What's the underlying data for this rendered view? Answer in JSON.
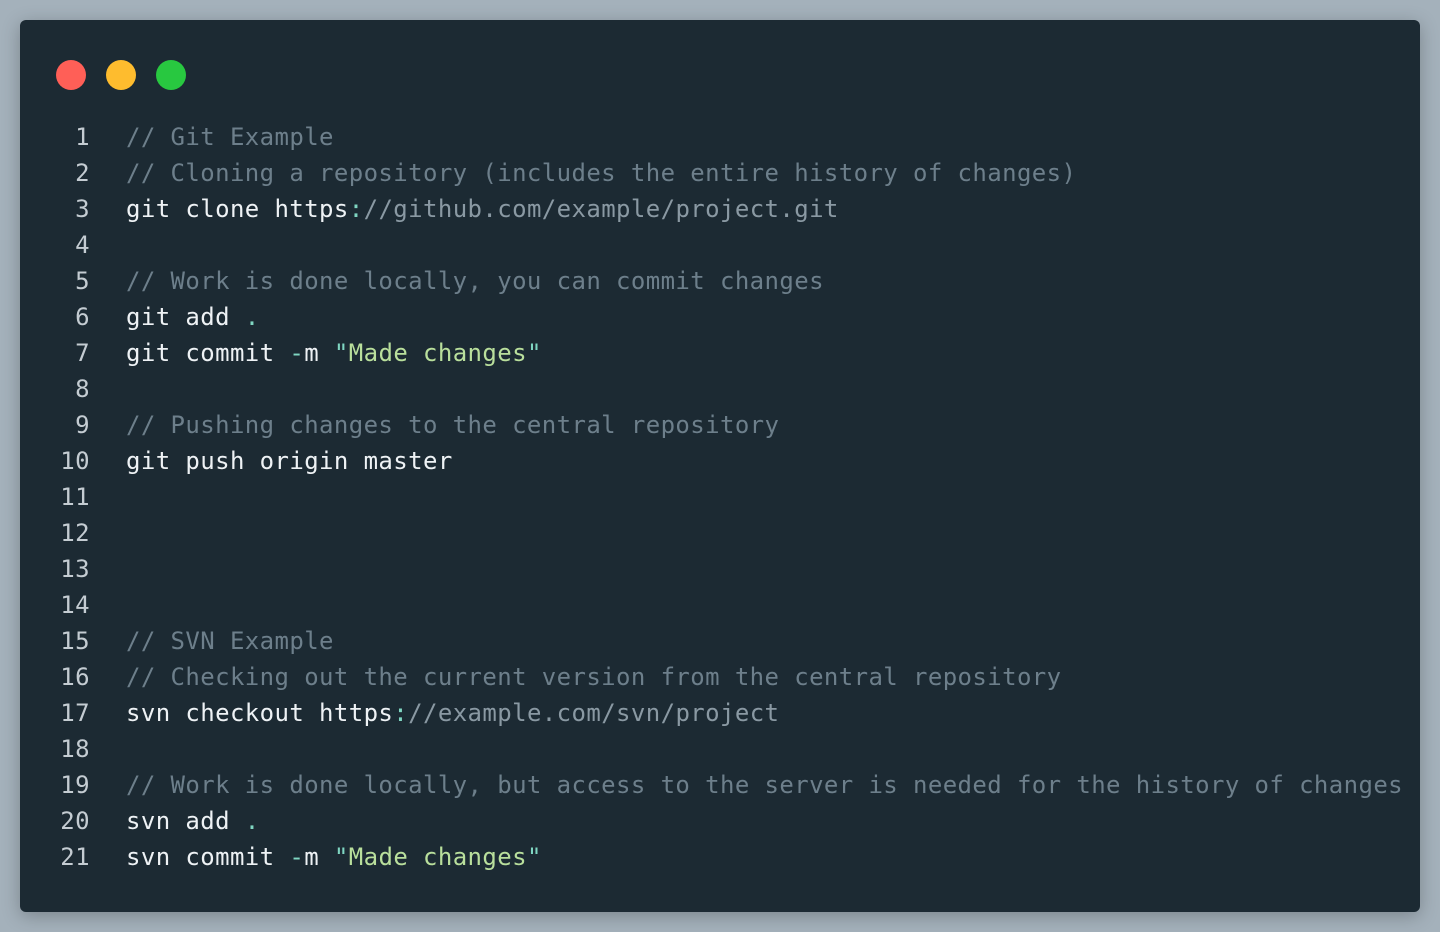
{
  "window": {
    "controls": [
      {
        "name": "close-button",
        "color": "#ff5f57"
      },
      {
        "name": "minimize-button",
        "color": "#febc2e"
      },
      {
        "name": "maximize-button",
        "color": "#28c840"
      }
    ]
  },
  "editor": {
    "lines": [
      {
        "n": "1",
        "tokens": [
          {
            "t": "comment",
            "v": "// Git Example"
          }
        ]
      },
      {
        "n": "2",
        "tokens": [
          {
            "t": "comment",
            "v": "// Cloning a repository (includes the entire history of changes)"
          }
        ]
      },
      {
        "n": "3",
        "tokens": [
          {
            "t": "text",
            "v": "git clone https"
          },
          {
            "t": "punct",
            "v": ":"
          },
          {
            "t": "url",
            "v": "//github.com/example/project.git"
          }
        ]
      },
      {
        "n": "4",
        "tokens": []
      },
      {
        "n": "5",
        "tokens": [
          {
            "t": "comment",
            "v": "// Work is done locally, you can commit changes"
          }
        ]
      },
      {
        "n": "6",
        "tokens": [
          {
            "t": "text",
            "v": "git add "
          },
          {
            "t": "punct",
            "v": "."
          }
        ]
      },
      {
        "n": "7",
        "tokens": [
          {
            "t": "text",
            "v": "git commit "
          },
          {
            "t": "punct",
            "v": "-"
          },
          {
            "t": "text",
            "v": "m "
          },
          {
            "t": "quote",
            "v": "\""
          },
          {
            "t": "string",
            "v": "Made changes"
          },
          {
            "t": "quote",
            "v": "\""
          }
        ]
      },
      {
        "n": "8",
        "tokens": []
      },
      {
        "n": "9",
        "tokens": [
          {
            "t": "comment",
            "v": "// Pushing changes to the central repository"
          }
        ]
      },
      {
        "n": "10",
        "tokens": [
          {
            "t": "text",
            "v": "git push origin master"
          }
        ]
      },
      {
        "n": "11",
        "tokens": []
      },
      {
        "n": "12",
        "tokens": []
      },
      {
        "n": "13",
        "tokens": []
      },
      {
        "n": "14",
        "tokens": []
      },
      {
        "n": "15",
        "tokens": [
          {
            "t": "comment",
            "v": "// SVN Example"
          }
        ]
      },
      {
        "n": "16",
        "tokens": [
          {
            "t": "comment",
            "v": "// Checking out the current version from the central repository"
          }
        ]
      },
      {
        "n": "17",
        "tokens": [
          {
            "t": "text",
            "v": "svn checkout https"
          },
          {
            "t": "punct",
            "v": ":"
          },
          {
            "t": "url",
            "v": "//example.com/svn/project"
          }
        ]
      },
      {
        "n": "18",
        "tokens": []
      },
      {
        "n": "19",
        "tokens": [
          {
            "t": "comment",
            "v": "// Work is done locally, but access to the server is needed for the history of changes"
          }
        ]
      },
      {
        "n": "20",
        "tokens": [
          {
            "t": "text",
            "v": "svn add "
          },
          {
            "t": "punct",
            "v": "."
          }
        ]
      },
      {
        "n": "21",
        "tokens": [
          {
            "t": "text",
            "v": "svn commit "
          },
          {
            "t": "punct",
            "v": "-"
          },
          {
            "t": "text",
            "v": "m "
          },
          {
            "t": "quote",
            "v": "\""
          },
          {
            "t": "string",
            "v": "Made changes"
          },
          {
            "t": "quote",
            "v": "\""
          }
        ]
      }
    ]
  }
}
